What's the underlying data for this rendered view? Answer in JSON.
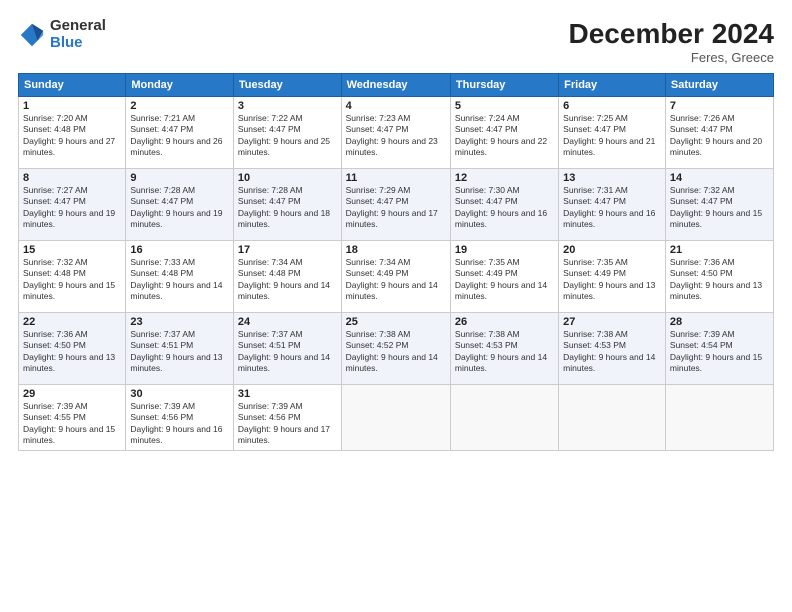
{
  "logo": {
    "general": "General",
    "blue": "Blue"
  },
  "title": "December 2024",
  "location": "Feres, Greece",
  "days_of_week": [
    "Sunday",
    "Monday",
    "Tuesday",
    "Wednesday",
    "Thursday",
    "Friday",
    "Saturday"
  ],
  "weeks": [
    [
      {
        "day": "1",
        "sunrise": "7:20 AM",
        "sunset": "4:48 PM",
        "daylight": "9 hours and 27 minutes."
      },
      {
        "day": "2",
        "sunrise": "7:21 AM",
        "sunset": "4:47 PM",
        "daylight": "9 hours and 26 minutes."
      },
      {
        "day": "3",
        "sunrise": "7:22 AM",
        "sunset": "4:47 PM",
        "daylight": "9 hours and 25 minutes."
      },
      {
        "day": "4",
        "sunrise": "7:23 AM",
        "sunset": "4:47 PM",
        "daylight": "9 hours and 23 minutes."
      },
      {
        "day": "5",
        "sunrise": "7:24 AM",
        "sunset": "4:47 PM",
        "daylight": "9 hours and 22 minutes."
      },
      {
        "day": "6",
        "sunrise": "7:25 AM",
        "sunset": "4:47 PM",
        "daylight": "9 hours and 21 minutes."
      },
      {
        "day": "7",
        "sunrise": "7:26 AM",
        "sunset": "4:47 PM",
        "daylight": "9 hours and 20 minutes."
      }
    ],
    [
      {
        "day": "8",
        "sunrise": "7:27 AM",
        "sunset": "4:47 PM",
        "daylight": "9 hours and 19 minutes."
      },
      {
        "day": "9",
        "sunrise": "7:28 AM",
        "sunset": "4:47 PM",
        "daylight": "9 hours and 19 minutes."
      },
      {
        "day": "10",
        "sunrise": "7:28 AM",
        "sunset": "4:47 PM",
        "daylight": "9 hours and 18 minutes."
      },
      {
        "day": "11",
        "sunrise": "7:29 AM",
        "sunset": "4:47 PM",
        "daylight": "9 hours and 17 minutes."
      },
      {
        "day": "12",
        "sunrise": "7:30 AM",
        "sunset": "4:47 PM",
        "daylight": "9 hours and 16 minutes."
      },
      {
        "day": "13",
        "sunrise": "7:31 AM",
        "sunset": "4:47 PM",
        "daylight": "9 hours and 16 minutes."
      },
      {
        "day": "14",
        "sunrise": "7:32 AM",
        "sunset": "4:47 PM",
        "daylight": "9 hours and 15 minutes."
      }
    ],
    [
      {
        "day": "15",
        "sunrise": "7:32 AM",
        "sunset": "4:48 PM",
        "daylight": "9 hours and 15 minutes."
      },
      {
        "day": "16",
        "sunrise": "7:33 AM",
        "sunset": "4:48 PM",
        "daylight": "9 hours and 14 minutes."
      },
      {
        "day": "17",
        "sunrise": "7:34 AM",
        "sunset": "4:48 PM",
        "daylight": "9 hours and 14 minutes."
      },
      {
        "day": "18",
        "sunrise": "7:34 AM",
        "sunset": "4:49 PM",
        "daylight": "9 hours and 14 minutes."
      },
      {
        "day": "19",
        "sunrise": "7:35 AM",
        "sunset": "4:49 PM",
        "daylight": "9 hours and 14 minutes."
      },
      {
        "day": "20",
        "sunrise": "7:35 AM",
        "sunset": "4:49 PM",
        "daylight": "9 hours and 13 minutes."
      },
      {
        "day": "21",
        "sunrise": "7:36 AM",
        "sunset": "4:50 PM",
        "daylight": "9 hours and 13 minutes."
      }
    ],
    [
      {
        "day": "22",
        "sunrise": "7:36 AM",
        "sunset": "4:50 PM",
        "daylight": "9 hours and 13 minutes."
      },
      {
        "day": "23",
        "sunrise": "7:37 AM",
        "sunset": "4:51 PM",
        "daylight": "9 hours and 13 minutes."
      },
      {
        "day": "24",
        "sunrise": "7:37 AM",
        "sunset": "4:51 PM",
        "daylight": "9 hours and 14 minutes."
      },
      {
        "day": "25",
        "sunrise": "7:38 AM",
        "sunset": "4:52 PM",
        "daylight": "9 hours and 14 minutes."
      },
      {
        "day": "26",
        "sunrise": "7:38 AM",
        "sunset": "4:53 PM",
        "daylight": "9 hours and 14 minutes."
      },
      {
        "day": "27",
        "sunrise": "7:38 AM",
        "sunset": "4:53 PM",
        "daylight": "9 hours and 14 minutes."
      },
      {
        "day": "28",
        "sunrise": "7:39 AM",
        "sunset": "4:54 PM",
        "daylight": "9 hours and 15 minutes."
      }
    ],
    [
      {
        "day": "29",
        "sunrise": "7:39 AM",
        "sunset": "4:55 PM",
        "daylight": "9 hours and 15 minutes."
      },
      {
        "day": "30",
        "sunrise": "7:39 AM",
        "sunset": "4:56 PM",
        "daylight": "9 hours and 16 minutes."
      },
      {
        "day": "31",
        "sunrise": "7:39 AM",
        "sunset": "4:56 PM",
        "daylight": "9 hours and 17 minutes."
      },
      null,
      null,
      null,
      null
    ]
  ],
  "labels": {
    "sunrise": "Sunrise:",
    "sunset": "Sunset:",
    "daylight": "Daylight:"
  }
}
